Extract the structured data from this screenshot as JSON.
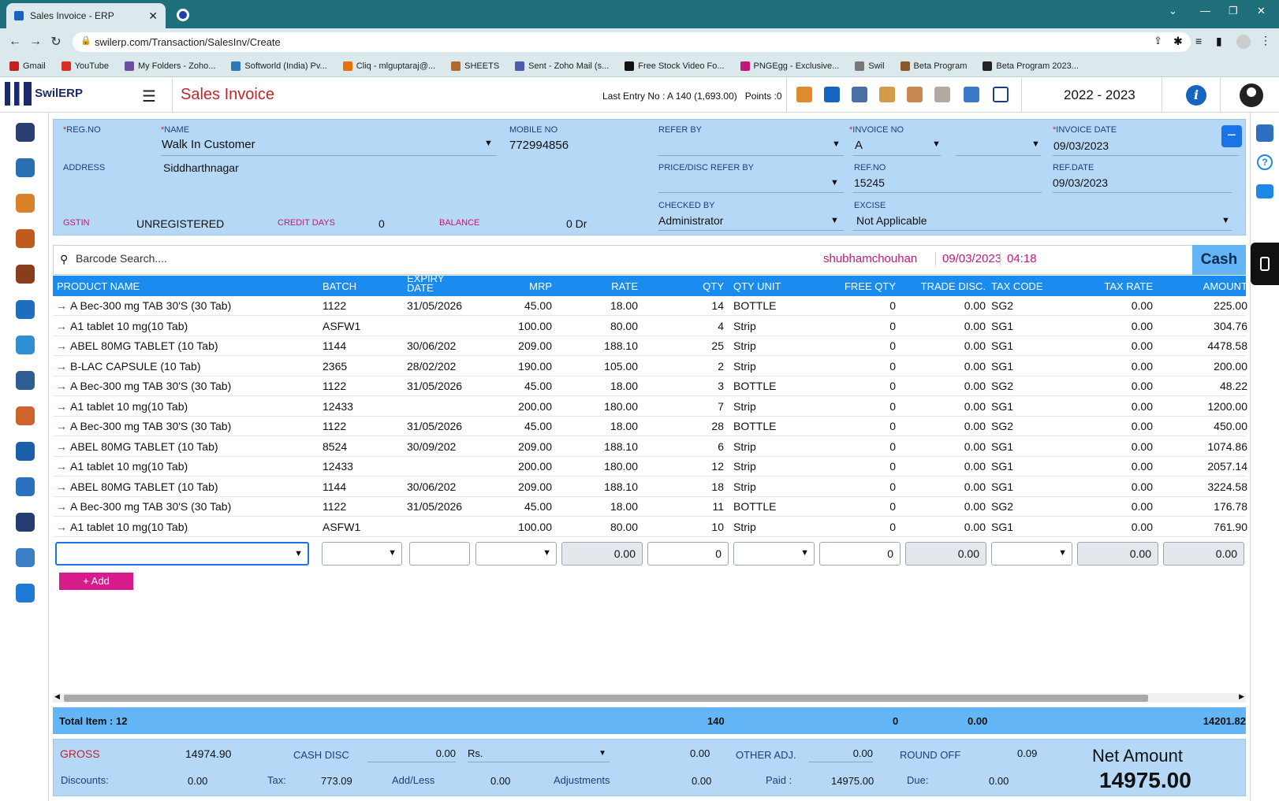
{
  "browser": {
    "tab_title": "Sales Invoice - ERP",
    "url": "swilerp.com/Transaction/SalesInv/Create",
    "bookmarks": [
      "Gmail",
      "YouTube",
      "My Folders - Zoho...",
      "Softworld (India) Pv...",
      "Cliq - mlguptaraj@...",
      "SHEETS",
      "Sent - Zoho Mail (s...",
      "Free Stock Video Fo...",
      "PNGEgg - Exclusive...",
      "Swil",
      "Beta Program",
      "Beta Program 2023..."
    ]
  },
  "app": {
    "logo": "SwilERP",
    "title": "Sales Invoice",
    "last_entry": "Last Entry No : A 140 (1,693.00)",
    "points": "Points :0",
    "year": "2022 - 2023",
    "info": "i"
  },
  "header": {
    "reg_no_label": "REG.NO",
    "name_label": "NAME",
    "name_value": "Walk In Customer",
    "mobile_label": "MOBILE NO",
    "mobile_value": "772994856",
    "refer_by_label": "REFER BY",
    "invoice_no_label": "INVOICE NO",
    "invoice_series": "A",
    "invoice_date_label": "INVOICE DATE",
    "invoice_date": "09/03/2023",
    "address_label": "ADDRESS",
    "address_value": "Siddharthnagar",
    "price_disc_label": "PRICE/DISC REFER BY",
    "ref_no_label": "REF.NO",
    "ref_no": "15245",
    "ref_date_label": "REF.DATE",
    "ref_date": "09/03/2023",
    "checked_by_label": "CHECKED BY",
    "checked_by": "Administrator",
    "excise_label": "EXCISE",
    "excise": "Not Applicable",
    "gstin_label": "GSTIN",
    "gstin": "UNREGISTERED",
    "credit_days_label": "CREDIT DAYS",
    "credit_days": "0",
    "balance_label": "BALANCE",
    "balance": "0 Dr"
  },
  "search": {
    "placeholder": "Barcode Search....",
    "user": "shubhamchouhan",
    "date": "09/03/2023",
    "time": "04:18",
    "cash": "Cash"
  },
  "table": {
    "headers": [
      "PRODUCT NAME",
      "BATCH",
      "EXPIRY DATE",
      "MRP",
      "RATE",
      "QTY",
      "QTY UNIT",
      "FREE QTY",
      "TRADE DISC.",
      "TAX CODE",
      "TAX RATE",
      "AMOUNT"
    ],
    "rows": [
      [
        "A Bec-300 mg TAB 30'S (30 Tab)",
        "1122",
        "31/05/2026",
        "45.00",
        "18.00",
        "14",
        "BOTTLE",
        "0",
        "0.00",
        "SG2",
        "0.00",
        "225.00"
      ],
      [
        "A1 tablet 10 mg(10 Tab)",
        "ASFW1",
        "",
        "100.00",
        "80.00",
        "4",
        "Strip",
        "0",
        "0.00",
        "SG1",
        "0.00",
        "304.76"
      ],
      [
        "ABEL 80MG TABLET (10 Tab)",
        "1144",
        "30/06/202",
        "209.00",
        "188.10",
        "25",
        "Strip",
        "0",
        "0.00",
        "SG1",
        "0.00",
        "4478.58"
      ],
      [
        "B-LAC CAPSULE (10 Tab)",
        "2365",
        "28/02/202",
        "190.00",
        "105.00",
        "2",
        "Strip",
        "0",
        "0.00",
        "SG1",
        "0.00",
        "200.00"
      ],
      [
        "A Bec-300 mg TAB 30'S (30 Tab)",
        "1122",
        "31/05/2026",
        "45.00",
        "18.00",
        "3",
        "BOTTLE",
        "0",
        "0.00",
        "SG2",
        "0.00",
        "48.22"
      ],
      [
        "A1 tablet 10 mg(10 Tab)",
        "12433",
        "",
        "200.00",
        "180.00",
        "7",
        "Strip",
        "0",
        "0.00",
        "SG1",
        "0.00",
        "1200.00"
      ],
      [
        "A Bec-300 mg TAB 30'S (30 Tab)",
        "1122",
        "31/05/2026",
        "45.00",
        "18.00",
        "28",
        "BOTTLE",
        "0",
        "0.00",
        "SG2",
        "0.00",
        "450.00"
      ],
      [
        "ABEL 80MG TABLET (10 Tab)",
        "8524",
        "30/09/202",
        "209.00",
        "188.10",
        "6",
        "Strip",
        "0",
        "0.00",
        "SG1",
        "0.00",
        "1074.86"
      ],
      [
        "A1 tablet 10 mg(10 Tab)",
        "12433",
        "",
        "200.00",
        "180.00",
        "12",
        "Strip",
        "0",
        "0.00",
        "SG1",
        "0.00",
        "2057.14"
      ],
      [
        "ABEL 80MG TABLET (10 Tab)",
        "1144",
        "30/06/202",
        "209.00",
        "188.10",
        "18",
        "Strip",
        "0",
        "0.00",
        "SG1",
        "0.00",
        "3224.58"
      ],
      [
        "A Bec-300 mg TAB 30'S (30 Tab)",
        "1122",
        "31/05/2026",
        "45.00",
        "18.00",
        "11",
        "BOTTLE",
        "0",
        "0.00",
        "SG2",
        "0.00",
        "176.78"
      ],
      [
        "A1 tablet 10 mg(10 Tab)",
        "ASFW1",
        "",
        "100.00",
        "80.00",
        "10",
        "Strip",
        "0",
        "0.00",
        "SG1",
        "0.00",
        "761.90"
      ]
    ]
  },
  "entry": {
    "rate": "0.00",
    "qty": "0",
    "free": "0",
    "disc": "0.00",
    "taxrate": "0.00",
    "amount": "0.00",
    "add": "+ Add"
  },
  "totals": {
    "items": "Total Item : 12",
    "qty": "140",
    "free": "0",
    "disc": "0.00",
    "amount": "14201.82"
  },
  "footer": {
    "gross_label": "GROSS",
    "gross": "14974.90",
    "cash_disc_label": "CASH DISC",
    "cash_disc": "0.00",
    "cash_disc_type": "Rs.",
    "cash_disc_amt": "0.00",
    "other_adj_label": "OTHER ADJ.",
    "other_adj": "0.00",
    "round_off_label": "ROUND OFF",
    "round_off": "0.09",
    "discounts_label": "Discounts:",
    "discounts": "0.00",
    "tax_label": "Tax:",
    "tax": "773.09",
    "addless_label": "Add/Less",
    "addless": "0.00",
    "adjustments_label": "Adjustments",
    "adjustments": "0.00",
    "paid_label": "Paid :",
    "paid": "14975.00",
    "due_label": "Due:",
    "due": "0.00",
    "net_label": "Net Amount",
    "net": "14975.00"
  },
  "colors": {
    "accent": "#1a8cf0",
    "header_bg": "#b5d8f7",
    "title": "#c0262d",
    "add": "#d81b8a"
  }
}
